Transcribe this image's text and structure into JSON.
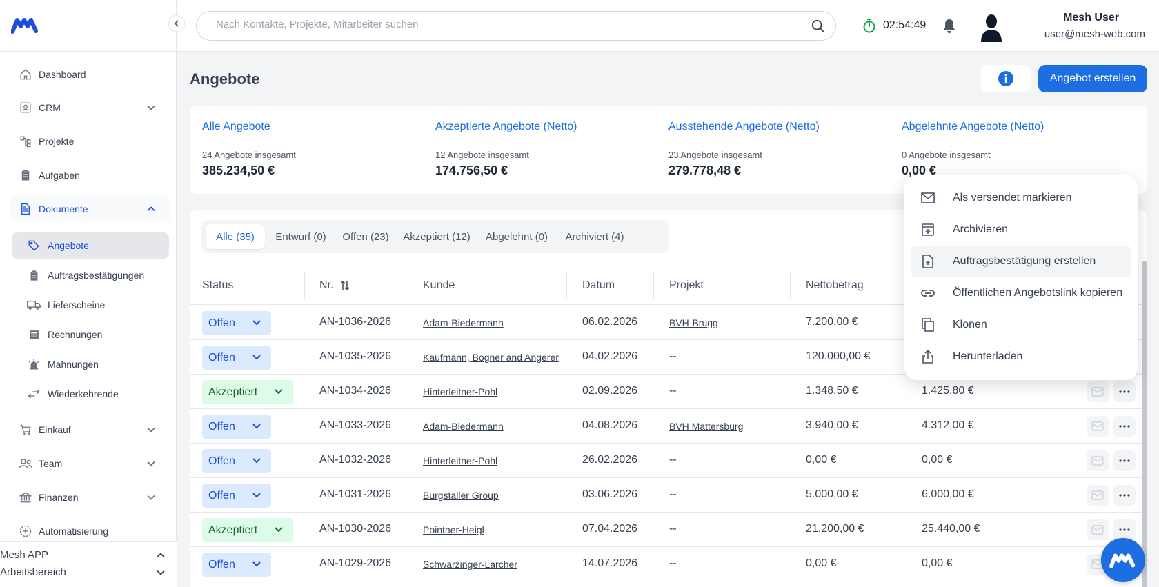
{
  "brand": {
    "accent": "#1d6ee0",
    "logo_icon": "mesh-logo"
  },
  "sidebar": {
    "items": [
      {
        "label": "Dashboard",
        "icon": "home-icon"
      },
      {
        "label": "CRM",
        "icon": "contacts-icon"
      },
      {
        "label": "Projekte",
        "icon": "project-icon"
      },
      {
        "label": "Aufgaben",
        "icon": "clipboard-icon"
      },
      {
        "label": "Dokumente",
        "icon": "document-icon"
      },
      {
        "label": "Einkauf",
        "icon": "cart-icon"
      },
      {
        "label": "Team",
        "icon": "team-icon"
      },
      {
        "label": "Finanzen",
        "icon": "bank-icon"
      },
      {
        "label": "Automatisierung",
        "icon": "automation-icon"
      }
    ],
    "sub_items": [
      {
        "label": "Angebote",
        "icon": "tag-icon"
      },
      {
        "label": "Auftragsbestätigungen",
        "icon": "clipboard-icon"
      },
      {
        "label": "Lieferscheine",
        "icon": "truck-icon"
      },
      {
        "label": "Rechnungen",
        "icon": "invoice-icon"
      },
      {
        "label": "Mahnungen",
        "icon": "alarm-icon"
      },
      {
        "label": "Wiederkehrende",
        "icon": "recurring-icon"
      }
    ],
    "footer": {
      "app": "Mesh APP",
      "workspace": "Arbeitsbereich"
    }
  },
  "header": {
    "search_placeholder": "Nach Kontakte, Projekte, Mitarbeiter suchen",
    "timer": "02:54:49",
    "user_name": "Mesh User",
    "user_email": "user@mesh-web.com"
  },
  "page": {
    "title": "Angebote",
    "create_label": "Angebot erstellen"
  },
  "stats": [
    {
      "title": "Alle Angebote",
      "count": "24 Angebote insgesamt",
      "value": "385.234,50 €"
    },
    {
      "title": "Akzeptierte Angebote (Netto)",
      "count": "12 Angebote insgesamt",
      "value": "174.756,50 €"
    },
    {
      "title": "Ausstehende Angebote (Netto)",
      "count": "23 Angebote insgesamt",
      "value": "279.778,48 €"
    },
    {
      "title": "Abgelehnte Angebote (Netto)",
      "count": "0 Angebote insgesamt",
      "value": "0,00 €"
    }
  ],
  "tabs": [
    "Alle (35)",
    "Entwurf (0)",
    "Offen (23)",
    "Akzeptiert (12)",
    "Abgelehnt (0)",
    "Archiviert (4)"
  ],
  "table": {
    "columns": [
      "Status",
      "Nr.",
      "Kunde",
      "Datum",
      "Projekt",
      "Nettobetrag"
    ],
    "rows": [
      {
        "status": "Offen",
        "nr": "AN-1036-2026",
        "kunde": "Adam-Biedermann",
        "datum": "06.02.2026",
        "projekt": "BVH-Brugg",
        "netto": "7.200,00 €",
        "brutto": ""
      },
      {
        "status": "Offen",
        "nr": "AN-1035-2026",
        "kunde": "Kaufmann, Bogner and Angerer",
        "datum": "04.02.2026",
        "projekt": "--",
        "netto": "120.000,00 €",
        "brutto": ""
      },
      {
        "status": "Akzeptiert",
        "nr": "AN-1034-2026",
        "kunde": "Hinterleitner-Pohl",
        "datum": "02.09.2026",
        "projekt": "--",
        "netto": "1.348,50 €",
        "brutto": "1.425,80 €"
      },
      {
        "status": "Offen",
        "nr": "AN-1033-2026",
        "kunde": "Adam-Biedermann",
        "datum": "04.08.2026",
        "projekt": "BVH Mattersburg",
        "netto": "3.940,00 €",
        "brutto": "4.312,00 €"
      },
      {
        "status": "Offen",
        "nr": "AN-1032-2026",
        "kunde": "Hinterleitner-Pohl",
        "datum": "26.02.2026",
        "projekt": "--",
        "netto": "0,00 €",
        "brutto": "0,00 €"
      },
      {
        "status": "Offen",
        "nr": "AN-1031-2026",
        "kunde": "Burgstaller Group",
        "datum": "03.06.2026",
        "projekt": "--",
        "netto": "5.000,00 €",
        "brutto": "6.000,00 €"
      },
      {
        "status": "Akzeptiert",
        "nr": "AN-1030-2026",
        "kunde": "Pointner-Heigl",
        "datum": "07.04.2026",
        "projekt": "--",
        "netto": "21.200,00 €",
        "brutto": "25.440,00 €"
      },
      {
        "status": "Offen",
        "nr": "AN-1029-2026",
        "kunde": "Schwarzinger-Larcher",
        "datum": "14.07.2026",
        "projekt": "--",
        "netto": "0,00 €",
        "brutto": "0,00 €"
      }
    ]
  },
  "menu": [
    {
      "label": "Als versendet markieren",
      "icon": "mail-icon"
    },
    {
      "label": "Archivieren",
      "icon": "archive-icon"
    },
    {
      "label": "Auftragsbestätigung erstellen",
      "icon": "file-plus-icon"
    },
    {
      "label": "Öffentlichen Angebotslink kopieren",
      "icon": "link-icon"
    },
    {
      "label": "Klonen",
      "icon": "copy-icon"
    },
    {
      "label": "Herunterladen",
      "icon": "share-icon"
    }
  ]
}
